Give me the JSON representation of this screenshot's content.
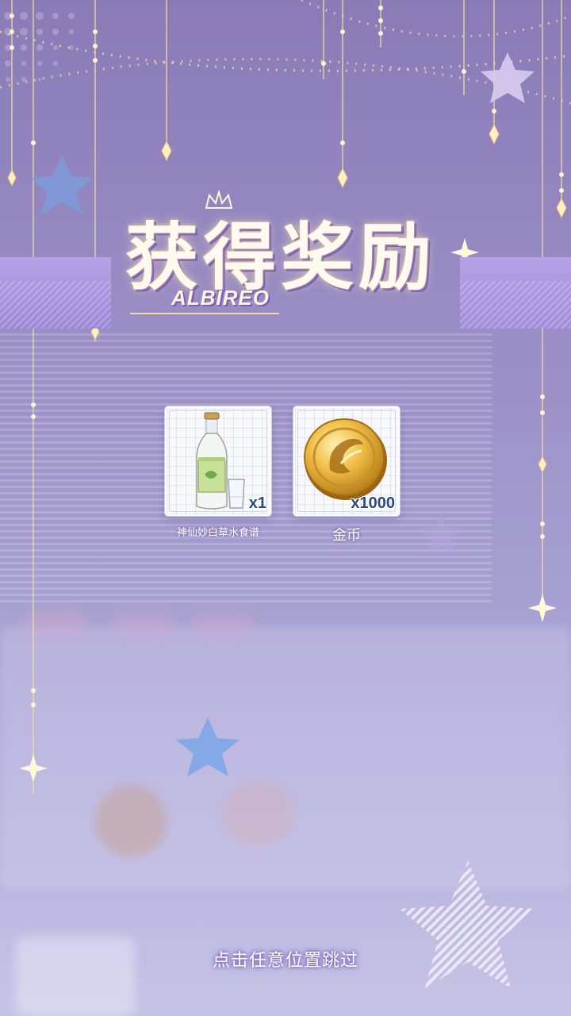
{
  "title": {
    "main": "获得奖励",
    "subtitle": "ALBIREO"
  },
  "rewards": [
    {
      "name": "神仙妙白草水食谱",
      "count": "x1",
      "icon": "liquor-bottle-icon"
    },
    {
      "name": "金币",
      "count": "x1000",
      "icon": "gold-coin-icon"
    }
  ],
  "skip_hint": "点击任意位置跳过",
  "colors": {
    "background_top": "#8a7bb7",
    "background_bottom": "#c6c4e6",
    "banner_purple": "#a28cdc",
    "gold_accent": "#f3dba6",
    "star_blue": "#7aa6e6"
  }
}
